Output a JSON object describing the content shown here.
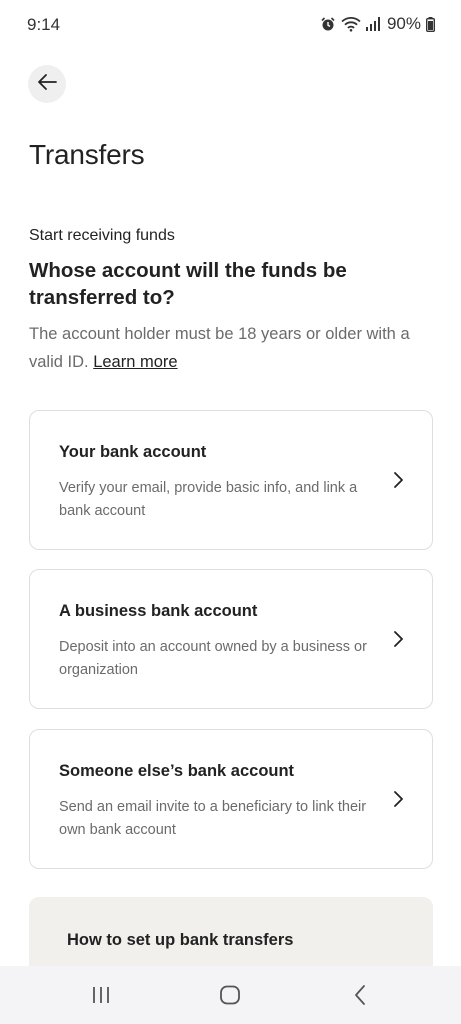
{
  "status_bar": {
    "time": "9:14",
    "battery": "90%",
    "icons": [
      "alarm-icon",
      "wifi-icon",
      "signal-icon",
      "battery-icon"
    ]
  },
  "header": {
    "back_icon": "arrow-left-icon",
    "title": "Transfers"
  },
  "intro": {
    "section_label": "Start receiving funds",
    "question": "Whose account will the funds be transferred to?",
    "helper_text": "The account holder must be 18 years or older with a valid ID.",
    "learn_more": "Learn more"
  },
  "options": [
    {
      "title": "Your bank account",
      "description": "Verify your email, provide basic info, and link a bank account"
    },
    {
      "title": "A business bank account",
      "description": "Deposit into an account owned by a business or organization"
    },
    {
      "title": "Someone else’s bank account",
      "description": "Send an email invite to a beneficiary to link their own bank account"
    }
  ],
  "howto": {
    "title": "How to set up bank transfers"
  },
  "nav_bar": {
    "icons": [
      "recent-apps-icon",
      "home-icon",
      "back-icon"
    ]
  },
  "colors": {
    "text_primary": "#222222",
    "text_secondary": "#6b6b6b",
    "card_border": "#dedede",
    "howto_background": "#f1f0ec"
  }
}
